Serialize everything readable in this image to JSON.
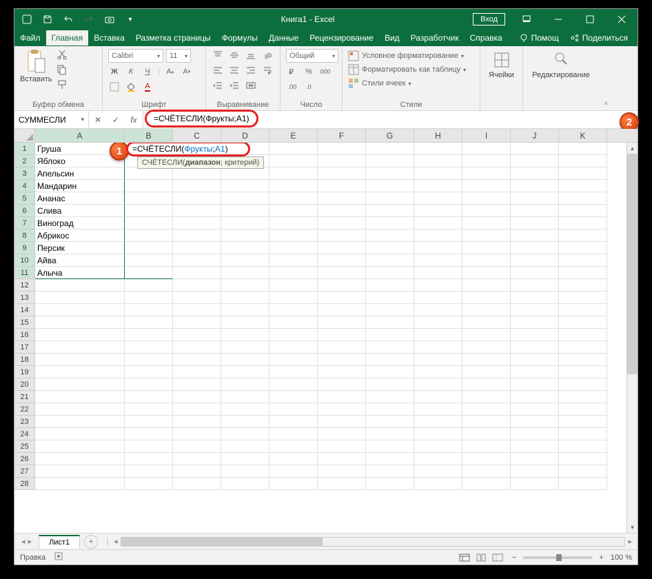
{
  "title": "Книга1  -  Excel",
  "login_btn": "Вход",
  "menu": {
    "file": "Файл",
    "home": "Главная",
    "insert": "Вставка",
    "layout": "Разметка страницы",
    "formulas": "Формулы",
    "data": "Данные",
    "review": "Рецензирование",
    "view": "Вид",
    "developer": "Разработчик",
    "help": "Справка",
    "tell_me": "Помощ",
    "share": "Поделиться"
  },
  "ribbon": {
    "paste": "Вставить",
    "clipboard": "Буфер обмена",
    "font_name": "Calibri",
    "font_size": "11",
    "font_group": "Шрифт",
    "align_group": "Выравнивание",
    "number_format": "Общий",
    "number_group": "Число",
    "cond_fmt": "Условное форматирование",
    "table_fmt": "Форматировать как таблицу",
    "cell_styles": "Стили ячеек",
    "styles_group": "Стили",
    "cells": "Ячейки",
    "editing": "Редактирование"
  },
  "name_box": "СУММЕСЛИ",
  "formula_text": "=СЧЁТЕСЛИ(Фрукты;A1)",
  "cell_formula_display": {
    "prefix": "=СЧЁТЕСЛИ(",
    "arg1": "Фрукты",
    "sep": ";",
    "arg2": "A1",
    "suffix": ")"
  },
  "tooltip": {
    "fn": "СЧЁТЕСЛИ(",
    "arg1": "диапазон",
    "rest": "; критерий)"
  },
  "badge1": "1",
  "badge2": "2",
  "columns": [
    "A",
    "B",
    "C",
    "D",
    "E",
    "F",
    "G",
    "H",
    "I",
    "J",
    "K"
  ],
  "col_width_A": 130,
  "col_width_default": 70,
  "rows": 28,
  "data_colA": [
    "Груша",
    "Яблоко",
    "Апельсин",
    "Мандарин",
    "Ананас",
    "Слива",
    "Виноград",
    "Абрикос",
    "Персик",
    "Айва",
    "Алыча"
  ],
  "sheet_tab": "Лист1",
  "status": "Правка",
  "zoom": "100 %"
}
